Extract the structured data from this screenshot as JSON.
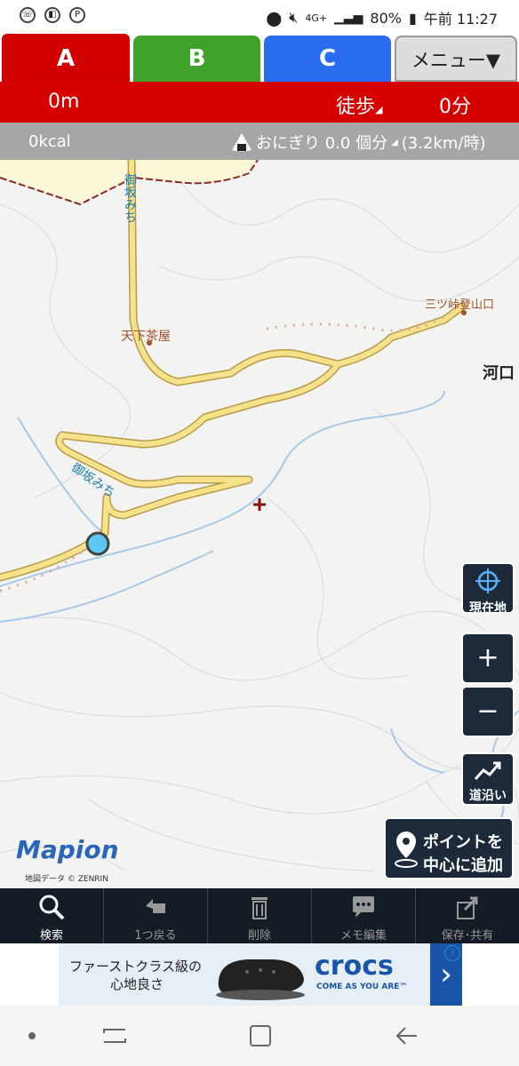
{
  "status_bar": {
    "battery": "80%",
    "time": "午前 11:27",
    "network": "4G+"
  },
  "tabs": [
    {
      "label": "A",
      "color": "#d00000"
    },
    {
      "label": "B",
      "color": "#3fa22a"
    },
    {
      "label": "C",
      "color": "#2a6cf0"
    }
  ],
  "menu_label": "メニュー▼",
  "route_info": {
    "distance": "0m",
    "mode": "徒歩",
    "duration": "0分"
  },
  "calorie_info": {
    "kcal": "0kcal",
    "onigiri": "おにぎり 0.0 個分",
    "speed": "(3.2km/時)"
  },
  "map": {
    "labels": {
      "road1": "御坂みち",
      "road2": "御坂みち",
      "place1": "天下茶屋",
      "place2": "三ツ峠登山口",
      "place3": "河口"
    },
    "logo": "Mapion",
    "credit": "地図データ © ZENRIN",
    "buttons": {
      "current_location": "現在地",
      "zoom_in": "+",
      "zoom_out": "−",
      "along_road": "道沿い",
      "add_point_line1": "ポイントを",
      "add_point_line2": "中心に追加"
    }
  },
  "toolbar": [
    {
      "label": "検索",
      "icon": "search-icon"
    },
    {
      "label": "1つ戻る",
      "icon": "undo-icon"
    },
    {
      "label": "削除",
      "icon": "trash-icon"
    },
    {
      "label": "メモ編集",
      "icon": "memo-icon"
    },
    {
      "label": "保存･共有",
      "icon": "share-icon"
    }
  ],
  "ad": {
    "text_line1": "ファーストクラス級の",
    "text_line2": "心地良さ",
    "brand": "crocs",
    "tagline": "COME AS YOU ARE™"
  },
  "colors": {
    "red": "#d50000",
    "toolbar_bg": "#141c26",
    "road": "#f6e28a"
  }
}
